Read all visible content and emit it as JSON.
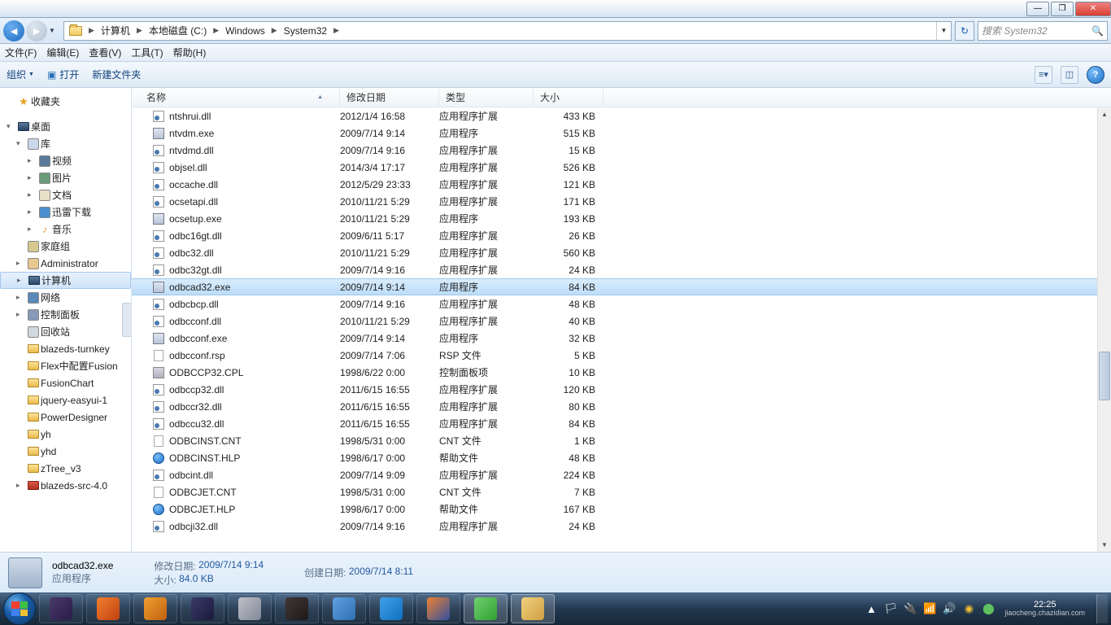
{
  "titlebar": {},
  "nav": {
    "breadcrumbs": [
      "计算机",
      "本地磁盘 (C:)",
      "Windows",
      "System32"
    ],
    "search_placeholder": "搜索 System32"
  },
  "menu": {
    "items": [
      "文件(F)",
      "编辑(E)",
      "查看(V)",
      "工具(T)",
      "帮助(H)"
    ]
  },
  "toolbar": {
    "organize": "组织",
    "open": "打开",
    "new_folder": "新建文件夹"
  },
  "sidebar": {
    "favorites": "收藏夹",
    "desktop": "桌面",
    "libraries": "库",
    "videos": "视频",
    "pictures": "图片",
    "documents": "文档",
    "downloads": "迅雷下载",
    "music": "音乐",
    "homegroup": "家庭组",
    "admin": "Administrator",
    "computer": "计算机",
    "network": "网络",
    "control_panel": "控制面板",
    "recycle": "回收站",
    "folders": [
      "blazeds-turnkey",
      "Flex中配置Fusion",
      "FusionChart",
      "jquery-easyui-1",
      "PowerDesigner",
      "yh",
      "yhd",
      "zTree_v3",
      "blazeds-src-4.0"
    ]
  },
  "columns": {
    "name": "名称",
    "date": "修改日期",
    "type": "类型",
    "size": "大小"
  },
  "files": [
    {
      "name": "ntshrui.dll",
      "date": "2012/1/4 16:58",
      "type": "应用程序扩展",
      "size": "433 KB",
      "icon": "dll"
    },
    {
      "name": "ntvdm.exe",
      "date": "2009/7/14 9:14",
      "type": "应用程序",
      "size": "515 KB",
      "icon": "exe"
    },
    {
      "name": "ntvdmd.dll",
      "date": "2009/7/14 9:16",
      "type": "应用程序扩展",
      "size": "15 KB",
      "icon": "dll"
    },
    {
      "name": "objsel.dll",
      "date": "2014/3/4 17:17",
      "type": "应用程序扩展",
      "size": "526 KB",
      "icon": "dll"
    },
    {
      "name": "occache.dll",
      "date": "2012/5/29 23:33",
      "type": "应用程序扩展",
      "size": "121 KB",
      "icon": "dll"
    },
    {
      "name": "ocsetapi.dll",
      "date": "2010/11/21 5:29",
      "type": "应用程序扩展",
      "size": "171 KB",
      "icon": "dll"
    },
    {
      "name": "ocsetup.exe",
      "date": "2010/11/21 5:29",
      "type": "应用程序",
      "size": "193 KB",
      "icon": "exe"
    },
    {
      "name": "odbc16gt.dll",
      "date": "2009/6/11 5:17",
      "type": "应用程序扩展",
      "size": "26 KB",
      "icon": "dll"
    },
    {
      "name": "odbc32.dll",
      "date": "2010/11/21 5:29",
      "type": "应用程序扩展",
      "size": "560 KB",
      "icon": "dll"
    },
    {
      "name": "odbc32gt.dll",
      "date": "2009/7/14 9:16",
      "type": "应用程序扩展",
      "size": "24 KB",
      "icon": "dll"
    },
    {
      "name": "odbcad32.exe",
      "date": "2009/7/14 9:14",
      "type": "应用程序",
      "size": "84 KB",
      "icon": "exe",
      "selected": true
    },
    {
      "name": "odbcbcp.dll",
      "date": "2009/7/14 9:16",
      "type": "应用程序扩展",
      "size": "48 KB",
      "icon": "dll"
    },
    {
      "name": "odbcconf.dll",
      "date": "2010/11/21 5:29",
      "type": "应用程序扩展",
      "size": "40 KB",
      "icon": "dll"
    },
    {
      "name": "odbcconf.exe",
      "date": "2009/7/14 9:14",
      "type": "应用程序",
      "size": "32 KB",
      "icon": "exe"
    },
    {
      "name": "odbcconf.rsp",
      "date": "2009/7/14 7:06",
      "type": "RSP 文件",
      "size": "5 KB",
      "icon": "file"
    },
    {
      "name": "ODBCCP32.CPL",
      "date": "1998/6/22 0:00",
      "type": "控制面板项",
      "size": "10 KB",
      "icon": "cpl"
    },
    {
      "name": "odbccp32.dll",
      "date": "2011/6/15 16:55",
      "type": "应用程序扩展",
      "size": "120 KB",
      "icon": "dll"
    },
    {
      "name": "odbccr32.dll",
      "date": "2011/6/15 16:55",
      "type": "应用程序扩展",
      "size": "80 KB",
      "icon": "dll"
    },
    {
      "name": "odbccu32.dll",
      "date": "2011/6/15 16:55",
      "type": "应用程序扩展",
      "size": "84 KB",
      "icon": "dll"
    },
    {
      "name": "ODBCINST.CNT",
      "date": "1998/5/31 0:00",
      "type": "CNT 文件",
      "size": "1 KB",
      "icon": "file"
    },
    {
      "name": "ODBCINST.HLP",
      "date": "1998/6/17 0:00",
      "type": "帮助文件",
      "size": "48 KB",
      "icon": "hlp"
    },
    {
      "name": "odbcint.dll",
      "date": "2009/7/14 9:09",
      "type": "应用程序扩展",
      "size": "224 KB",
      "icon": "dll"
    },
    {
      "name": "ODBCJET.CNT",
      "date": "1998/5/31 0:00",
      "type": "CNT 文件",
      "size": "7 KB",
      "icon": "file"
    },
    {
      "name": "ODBCJET.HLP",
      "date": "1998/6/17 0:00",
      "type": "帮助文件",
      "size": "167 KB",
      "icon": "hlp"
    },
    {
      "name": "odbcji32.dll",
      "date": "2009/7/14 9:16",
      "type": "应用程序扩展",
      "size": "24 KB",
      "icon": "dll"
    }
  ],
  "details": {
    "file_name": "odbcad32.exe",
    "file_type": "应用程序",
    "mod_label": "修改日期:",
    "mod_value": "2009/7/14 9:14",
    "size_label": "大小:",
    "size_value": "84.0 KB",
    "create_label": "创建日期:",
    "create_value": "2009/7/14 8:11"
  },
  "taskbar": {
    "apps": [
      {
        "name": "eclipse",
        "color": "linear-gradient(135deg,#4a3a6a,#2a1a4a)"
      },
      {
        "name": "notepad",
        "color": "linear-gradient(135deg,#f08030,#c04010)"
      },
      {
        "name": "matlab",
        "color": "linear-gradient(135deg,#f0a030,#c06010)"
      },
      {
        "name": "app8",
        "color": "linear-gradient(135deg,#3a3a6a,#1a1a3a)"
      },
      {
        "name": "snip",
        "color": "linear-gradient(135deg,#c0c0c8,#808898)"
      },
      {
        "name": "flash",
        "color": "linear-gradient(135deg,#403838,#201818)"
      },
      {
        "name": "cube",
        "color": "linear-gradient(135deg,#60a0e0,#3070b0)"
      },
      {
        "name": "cloud",
        "color": "linear-gradient(135deg,#40a0e8,#1070c0)"
      },
      {
        "name": "firefox",
        "color": "linear-gradient(135deg,#f08030,#3050a0)"
      },
      {
        "name": "ie",
        "color": "linear-gradient(135deg,#70d070,#30a030)",
        "active": true
      },
      {
        "name": "explorer",
        "color": "linear-gradient(135deg,#f0d080,#d0a040)",
        "active": true
      }
    ],
    "time": "22:25",
    "date_hint": "jiaocheng.chazidian.com"
  }
}
